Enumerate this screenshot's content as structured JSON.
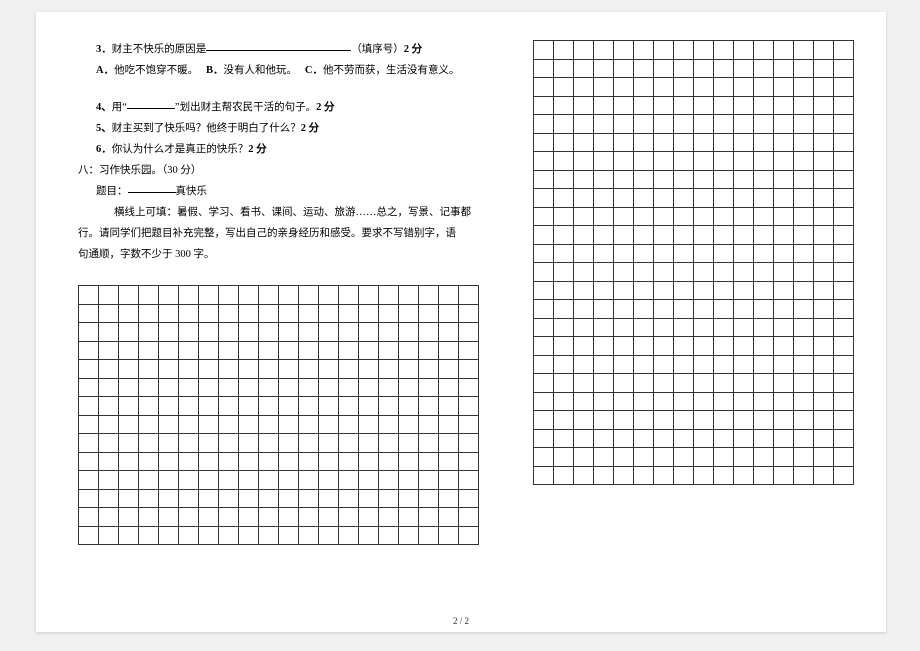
{
  "questions": {
    "q3": {
      "num": "3．",
      "text_before": "财主不快乐的原因是",
      "text_after": "（填序号）",
      "points": "2 分"
    },
    "q3_options": {
      "a_label": "A．",
      "a_text": "他吃不饱穿不暖。",
      "b_label": "B．",
      "b_text": "没有人和他玩。",
      "c_label": "C．",
      "c_text": "他不劳而获，生活没有意义。"
    },
    "q4": {
      "num": "4、",
      "text_before": "用“",
      "text_after": "”划出财主帮农民干活的句子。",
      "points": "2 分"
    },
    "q5": {
      "num": "5、",
      "text": "财主买到了快乐吗？他终于明白了什么？",
      "points": "2 分"
    },
    "q6": {
      "num": "6．",
      "text": "你认为什么才是真正的快乐？",
      "points": "2 分"
    }
  },
  "section8": {
    "heading": "八：习作快乐园。（30 分）",
    "topic_label": "题目：",
    "topic_suffix": "真快乐",
    "para1": "横线上可填：暑假、学习、看书、课间、运动、旅游……总之，写景、记事都",
    "para2": "行。请同学们把题目补充完整，写出自己的亲身经历和感受。要求不写错别字，语",
    "para3": "句通顺，字数不少于 300 字。"
  },
  "footer": "2 / 2",
  "grids": {
    "left": {
      "rows": 14,
      "cols": 20
    },
    "right": {
      "rows": 24,
      "cols": 16
    }
  }
}
